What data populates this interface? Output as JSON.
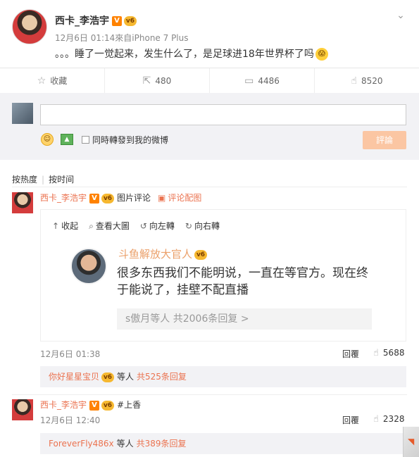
{
  "post": {
    "username": "西卡_李浩宇",
    "verified_badge": "V",
    "vip_badge": "v6",
    "meta": "12月6日 01:14來自iPhone 7 Plus",
    "text": "。。。睡了一觉起来，发生什么了，是足球进18年世界杯了吗",
    "text_emoji": "😱"
  },
  "actions": [
    {
      "icon": "star-icon",
      "glyph": "☆",
      "label": "收藏"
    },
    {
      "icon": "repost-icon",
      "glyph": "⇱",
      "label": "480"
    },
    {
      "icon": "comment-icon",
      "glyph": "▭",
      "label": "4486"
    },
    {
      "icon": "thumbs-up-icon",
      "glyph": "👍",
      "label": "8520"
    }
  ],
  "composer": {
    "repost_label": "同時轉發到我的微博",
    "reply_button": "評論"
  },
  "sort": {
    "by_hot": "按热度",
    "by_time": "按时间"
  },
  "comments": [
    {
      "username": "西卡_李浩宇",
      "text": "图片评论",
      "link": "评论配图",
      "time": "12月6日 01:38",
      "reply": "回覆",
      "likes": "5688",
      "sub_user": "你好星星宝贝",
      "sub_mid": "等人",
      "sub_count": "共525条回复"
    },
    {
      "username": "西卡_李浩宇",
      "text": "#上香",
      "time": "12月6日 12:40",
      "reply": "回覆",
      "likes": "2328",
      "sub_user": "ForeverFly486x",
      "sub_mid": "等人",
      "sub_count": "共389条回复"
    }
  ],
  "image_viewer": {
    "collapse": "收起",
    "view_large": "查看大圖",
    "rotate_left": "向左轉",
    "rotate_right": "向右轉"
  },
  "snapshot": {
    "name": "斗鱼解放大官人",
    "text": "很多东西我们不能明说，一直在等官方。现在终于能说了，挂壁不配直播",
    "footer": "s傲月等人 共2006条回复 >"
  },
  "colors": {
    "accent": "#eb7350",
    "verified": "#ff8200",
    "reply_button": "#fbc6a3"
  }
}
